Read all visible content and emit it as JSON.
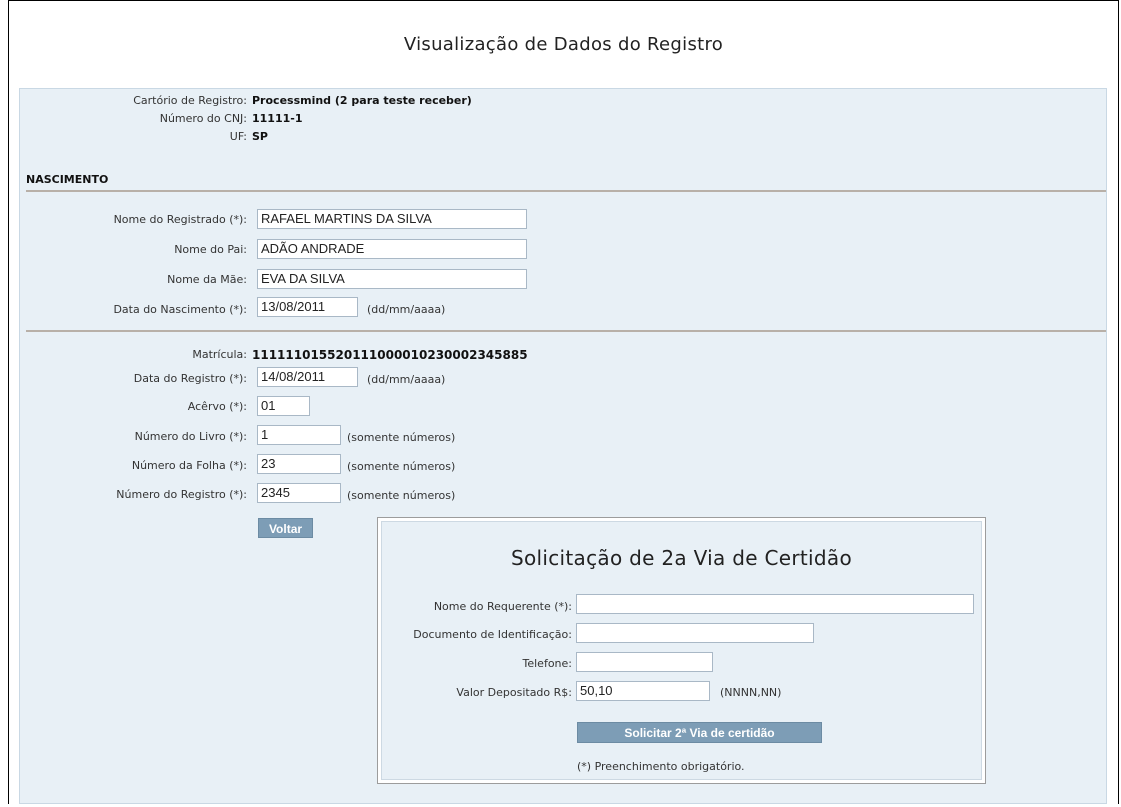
{
  "page": {
    "title": "Visualização de Dados do Registro"
  },
  "header_info": [
    {
      "label": "Cartório de Registro:",
      "value": "Processmind (2 para teste receber)"
    },
    {
      "label": "Número do CNJ:",
      "value": "11111-1"
    },
    {
      "label": "UF:",
      "value": "SP"
    }
  ],
  "section": {
    "title": "NASCIMENTO"
  },
  "nascimento": {
    "nome_registrado": {
      "label": "Nome do Registrado (*):",
      "value": "RAFAEL MARTINS DA SILVA"
    },
    "nome_pai": {
      "label": "Nome do Pai:",
      "value": "ADÃO ANDRADE"
    },
    "nome_mae": {
      "label": "Nome da Mãe:",
      "value": "EVA DA SILVA"
    },
    "data_nascimento": {
      "label": "Data do Nascimento (*):",
      "value": "13/08/2011",
      "hint": "(dd/mm/aaaa)"
    }
  },
  "registro": {
    "matricula": {
      "label": "Matrícula:",
      "value": "111111015520111000010230002345885"
    },
    "data_registro": {
      "label": "Data do Registro (*):",
      "value": "14/08/2011",
      "hint": "(dd/mm/aaaa)"
    },
    "acervo": {
      "label": "Acêrvo (*):",
      "value": "01"
    },
    "numero_livro": {
      "label": "Número do Livro (*):",
      "value": "1",
      "hint": "(somente números)"
    },
    "numero_folha": {
      "label": "Número da Folha (*):",
      "value": "23",
      "hint": "(somente números)"
    },
    "numero_registro": {
      "label": "Número do Registro (*):",
      "value": "2345",
      "hint": "(somente números)"
    }
  },
  "buttons": {
    "voltar": "Voltar",
    "solicitar": "Solicitar 2ª Via de certidão"
  },
  "request": {
    "title": "Solicitação de 2a Via de Certidão",
    "nome_requerente": {
      "label": "Nome do Requerente (*):",
      "value": ""
    },
    "documento": {
      "label": "Documento de Identificação:",
      "value": ""
    },
    "telefone": {
      "label": "Telefone:",
      "value": ""
    },
    "valor": {
      "label": "Valor Depositado R$:",
      "value": "50,10",
      "hint": "(NNNN,NN)"
    },
    "note": "(*) Preenchimento obrigatório."
  },
  "colors": {
    "panel_bg": "#e8f0f6",
    "button_bg": "#7d9db6",
    "divider": "#b8b0a8"
  }
}
